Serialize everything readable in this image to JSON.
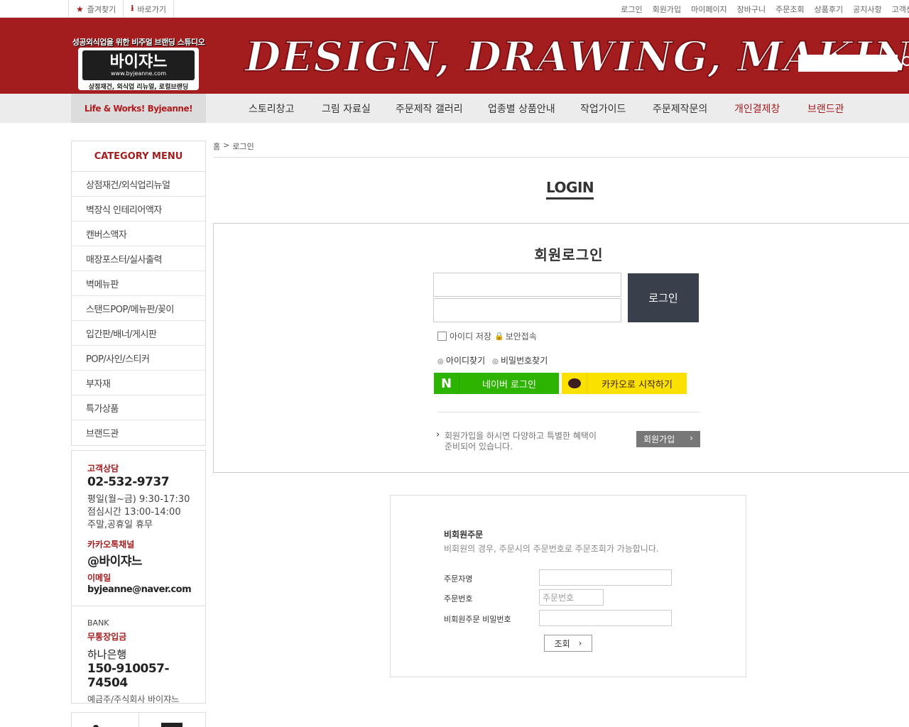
{
  "topbar": {
    "quick": [
      {
        "icon": "star-icon",
        "label": "즐겨찾기"
      },
      {
        "icon": "download-icon",
        "label": "바로가기"
      }
    ],
    "links": [
      "로그인",
      "회원가입",
      "마이페이지",
      "장바구니",
      "주문조회",
      "상품후기",
      "공지사항",
      "고객센"
    ]
  },
  "header": {
    "logo_tagline": "성공외식업을 위한 비주얼 브랜딩 스튜디오",
    "logo_name": "바이쟈느",
    "logo_url": "www.byjeanne.com",
    "logo_sub": "상점재건, 외식업 리뉴얼, 로컬브랜딩",
    "hero": "DESIGN, DRAWING, MAKING",
    "search_placeholder": ""
  },
  "nav": {
    "life": "Life & Works! Byjeanne!",
    "items": [
      {
        "label": "스토리창고",
        "accent": false
      },
      {
        "label": "그림 자료실",
        "accent": false
      },
      {
        "label": "주문제작 갤러리",
        "accent": false
      },
      {
        "label": "업종별 상품안내",
        "accent": false
      },
      {
        "label": "작업가이드",
        "accent": false
      },
      {
        "label": "주문제작문의",
        "accent": false
      },
      {
        "label": "개인결제창",
        "accent": true
      },
      {
        "label": "브랜드관",
        "accent": true
      }
    ]
  },
  "sidebar": {
    "title": "CATEGORY MENU",
    "items": [
      "상점재건/외식업리뉴얼",
      "벽장식 인테리어액자",
      "캔버스액자",
      "매장포스터/실사출력",
      "벽메뉴판",
      "스탠드POP/메뉴판/꽂이",
      "입간판/배너/게시판",
      "POP/사인/스티커",
      "부자재",
      "특가상품",
      "브랜드관"
    ],
    "cs": {
      "label": "고객상담",
      "phone": "02-532-9737",
      "hours": [
        "평일(월~금) 9:30-17:30",
        "점심시간 13:00-14:00",
        "주말,공휴일 휴무"
      ],
      "kakao_label": "카카오톡채널",
      "kakao_id": "@바이쟈느",
      "email_label": "이메일",
      "email": "byjeanne@naver.com"
    },
    "bank": {
      "title": "BANK",
      "label": "무통장입금",
      "name": "하나은행",
      "account": "150-910057-74504",
      "holder": "예금주/주식회사 바이쟈느"
    }
  },
  "breadcrumb": {
    "home": "홈",
    "sep": ">",
    "current": "로그인"
  },
  "login": {
    "page_title": "LOGIN",
    "heading": "회원로그인",
    "id_value": "",
    "pw_value": "",
    "login_button": "로그인",
    "save_id": "아이디 저장",
    "secure": "보안접속",
    "find_id": "아이디찾기",
    "find_pw": "비밀번호찾기",
    "naver": "네이버 로그인",
    "kakao": "카카오로 시작하기",
    "join_text": "회원가입을 하시면 다양하고 특별한 혜택이 준비되어 있습니다.",
    "join_button": "회원가입"
  },
  "guest": {
    "title": "비회원주문",
    "desc": "비회원의 경우, 주문시의 주문번호로 주문조회가 가능합니다.",
    "name_label": "주문자명",
    "order_label": "주문번호",
    "order_placeholder": "주문번호",
    "pw_label": "비회원주문 비밀번호",
    "search_button": "조회"
  },
  "colors": {
    "brand": "#a31d1f",
    "login_button": "#3a3f4c",
    "naver": "#2db400",
    "kakao": "#fae100"
  }
}
